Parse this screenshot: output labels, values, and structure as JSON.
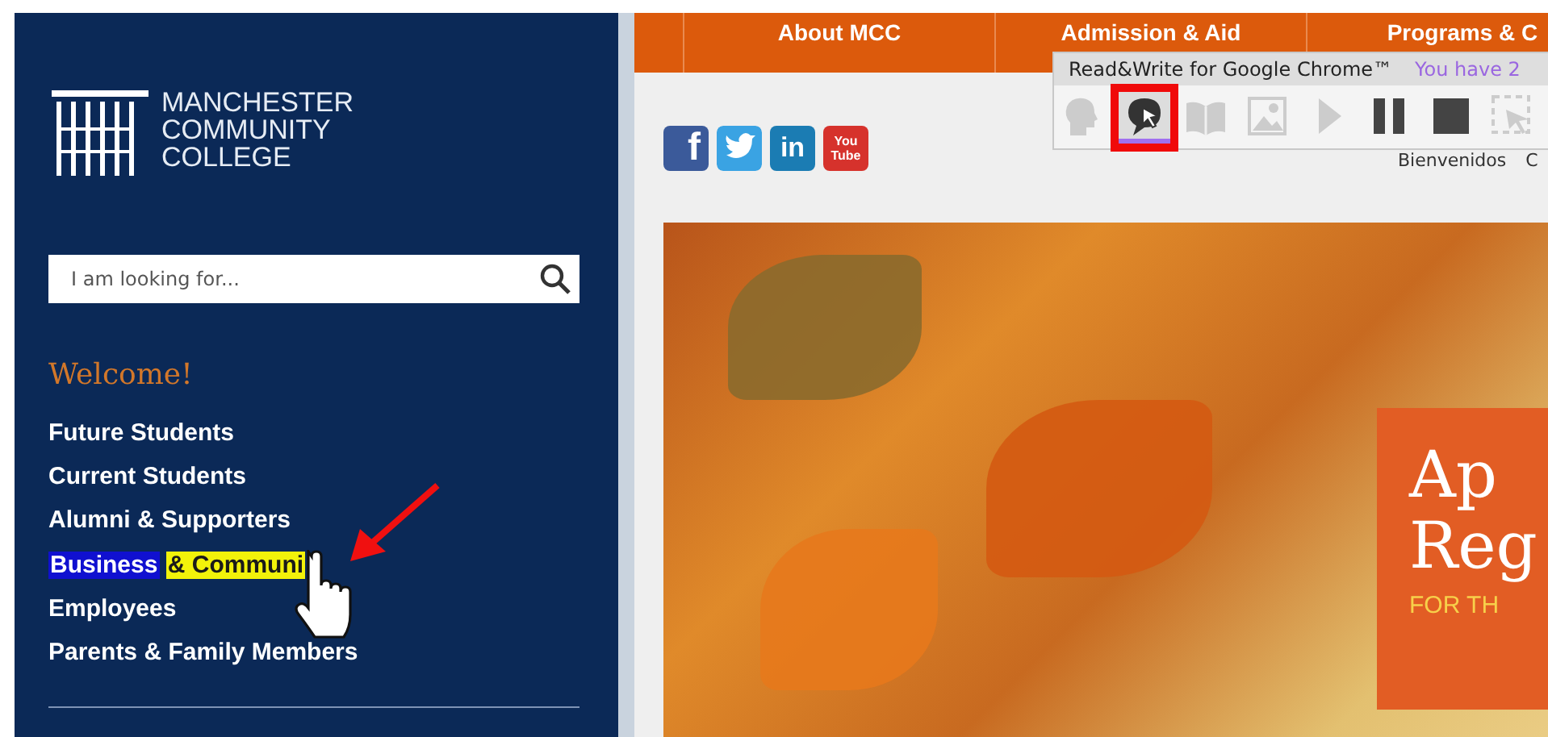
{
  "logo": {
    "lines": [
      "MANCHESTER",
      "COMMUNITY",
      "COLLEGE"
    ]
  },
  "search": {
    "placeholder": "I am looking for..."
  },
  "sidebar": {
    "heading": "Welcome!",
    "items": [
      {
        "label": "Future Students"
      },
      {
        "label": "Current Students"
      },
      {
        "label": "Alumni & Supporters"
      },
      {
        "segments": [
          {
            "text": "Business",
            "color": "#1010d0"
          },
          {
            "text": "& Communi",
            "color": "#f2f20a"
          }
        ]
      },
      {
        "label": "Employees"
      },
      {
        "label": "Parents & Family Members"
      }
    ]
  },
  "nav": {
    "items": [
      "About MCC",
      "Admission & Aid",
      "Programs & C"
    ]
  },
  "social": [
    {
      "kind": "facebook",
      "glyph": "f"
    },
    {
      "kind": "twitter"
    },
    {
      "kind": "linkedin",
      "glyph": "in"
    },
    {
      "kind": "youtube",
      "glyph": "You Tube"
    }
  ],
  "language_links": [
    "Bienvenidos",
    "C"
  ],
  "toolbar": {
    "title": "Read&Write for Google Chrome™",
    "notice": "You have 2",
    "tools": [
      {
        "kind": "speak",
        "selected": false
      },
      {
        "kind": "hover-speech",
        "selected": true
      },
      {
        "kind": "dictionary",
        "selected": false
      },
      {
        "kind": "picture",
        "selected": false
      },
      {
        "kind": "play",
        "selected": false
      },
      {
        "kind": "pause",
        "selected": false
      },
      {
        "kind": "stop",
        "selected": false
      },
      {
        "kind": "select",
        "selected": false
      }
    ]
  },
  "banner": {
    "lines": [
      "Ap",
      "Reg"
    ],
    "subline": "FOR TH"
  }
}
